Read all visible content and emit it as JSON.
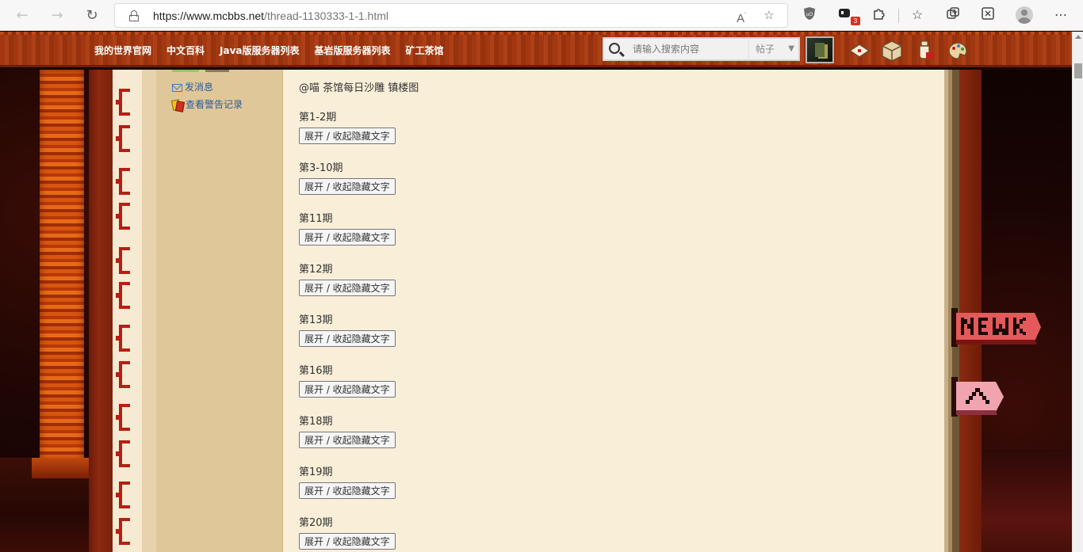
{
  "browser": {
    "url_host": "https://www.mcbbs.net",
    "url_path": "/thread-1130333-1-1.html",
    "extension_badge": "3"
  },
  "header": {
    "nav": [
      "我的世界官网",
      "中文百科",
      "Java版服务器列表",
      "基岩版服务器列表",
      "矿工茶馆"
    ],
    "search_placeholder": "请输入搜索内容",
    "search_type": "帖子"
  },
  "sidebar": {
    "send_message": "发消息",
    "warning_record": "查看警告记录"
  },
  "post": {
    "title": "@喵 茶馆每日沙雕 镇楼图",
    "toggle_label": "展开 / 收起隐藏文字",
    "issues": [
      "第1-2期",
      "第3-10期",
      "第11期",
      "第12期",
      "第13期",
      "第16期",
      "第18期",
      "第19期",
      "第20期"
    ]
  },
  "colors": {
    "header_red": "#a23811",
    "sidebar_tan": "#e0c79a",
    "content_cream": "#f9eed8",
    "link_blue": "#2a5b9a"
  }
}
